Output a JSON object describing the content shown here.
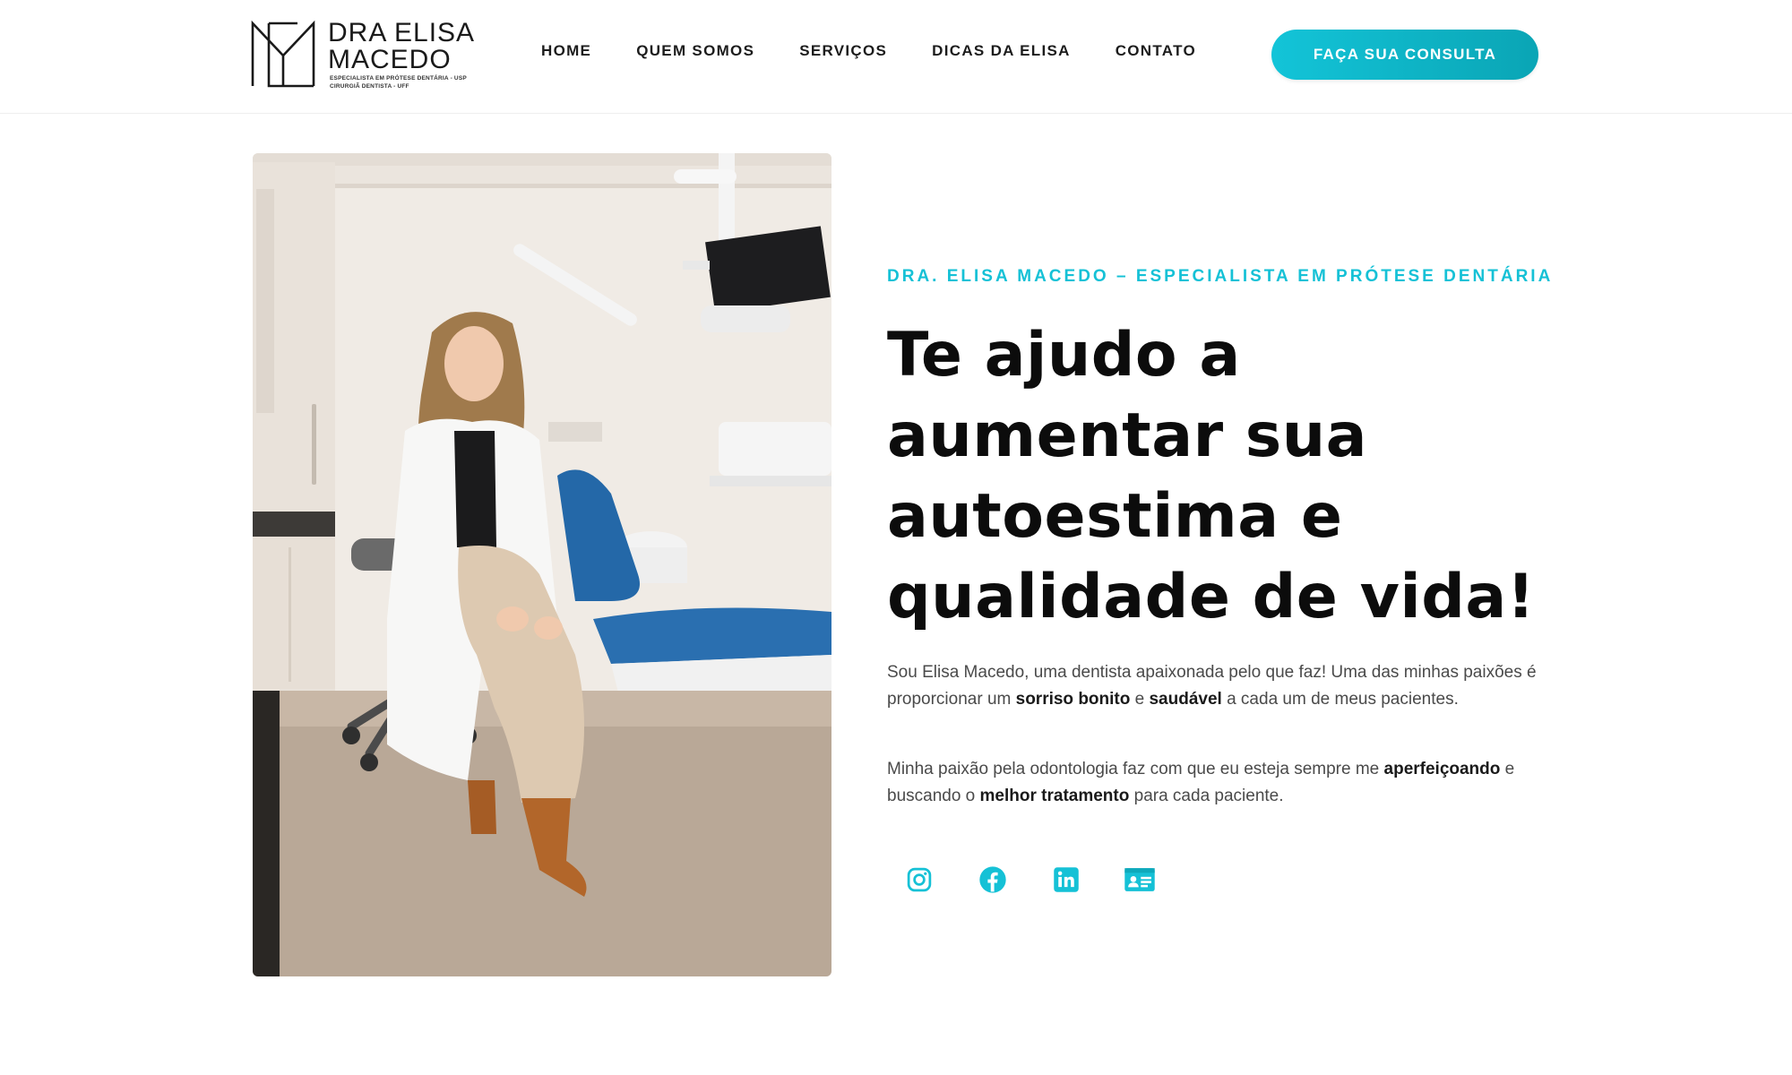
{
  "brand": {
    "name_line1": "DRA ELISA",
    "name_line2": "MACEDO",
    "tagline_line1": "ESPECIALISTA EM PRÓTESE DENTÁRIA - USP",
    "tagline_line2": "CIRURGIÃ DENTISTA - UFF",
    "accent_color": "#15c1d6"
  },
  "nav": {
    "items": [
      {
        "label": "HOME"
      },
      {
        "label": "QUEM SOMOS"
      },
      {
        "label": "SERVIÇOS"
      },
      {
        "label": "DICAS DA ELISA"
      },
      {
        "label": "CONTATO"
      }
    ],
    "cta_label": "FAÇA SUA CONSULTA"
  },
  "hero": {
    "eyebrow": "DRA. ELISA MACEDO – ESPECIALISTA EM PRÓTESE DENTÁRIA",
    "headline": [
      "Te ajudo a",
      "aumentar sua",
      "autoestima e",
      "qualidade de vida!"
    ],
    "paragraph1": {
      "t1": "Sou Elisa Macedo, uma dentista apaixonada pelo que faz! Uma das minhas paixões é proporcionar um ",
      "b1": "sorriso bonito",
      "t2": " e ",
      "b2": "saudável",
      "t3": " a cada um de meus pacientes."
    },
    "paragraph2": {
      "t1": "Minha paixão pela odontologia faz com que eu esteja sempre me ",
      "b1": "aperfeiçoando",
      "t2": " e buscando o ",
      "b2": "melhor tratamento",
      "t3": " para cada paciente."
    },
    "photo_icon": "dentist-photo",
    "socials": [
      {
        "icon": "instagram-icon"
      },
      {
        "icon": "facebook-icon"
      },
      {
        "icon": "linkedin-icon"
      },
      {
        "icon": "contact-card-icon"
      }
    ]
  }
}
